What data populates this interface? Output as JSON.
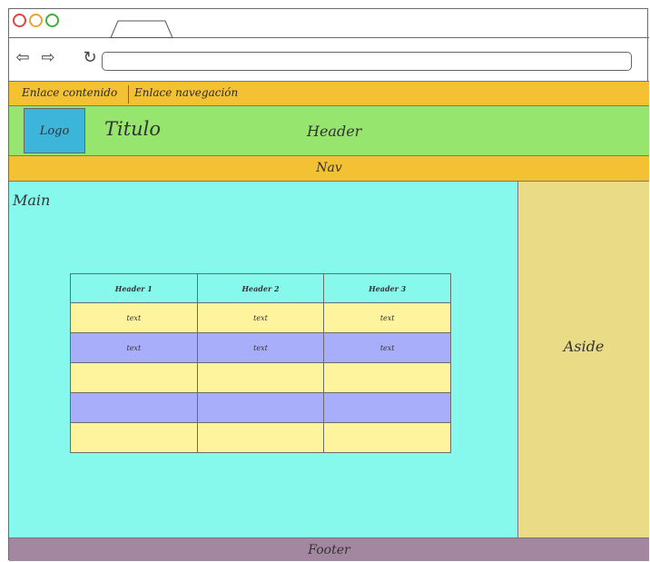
{
  "browser": {
    "back_icon": "⇦",
    "forward_icon": "⇨",
    "reload_icon": "↻"
  },
  "links_bar": {
    "link1": "Enlace contenido",
    "link2": "Enlace navegación"
  },
  "header": {
    "logo": "Logo",
    "title": "Titulo",
    "label": "Header"
  },
  "nav": {
    "label": "Nav"
  },
  "main": {
    "label": "Main",
    "table": {
      "headers": [
        "Header 1",
        "Header 2",
        "Header 3"
      ],
      "rows": [
        [
          "text",
          "text",
          "text"
        ],
        [
          "text",
          "text",
          "text"
        ],
        [
          "",
          "",
          ""
        ],
        [
          "",
          "",
          ""
        ],
        [
          "",
          "",
          ""
        ]
      ]
    }
  },
  "aside": {
    "label": "Aside"
  },
  "footer": {
    "label": "Footer"
  },
  "colors": {
    "links_bar": "#f4c134",
    "header": "#96e56f",
    "logo": "#3db4d9",
    "main": "#87f9ec",
    "aside": "#eadc87",
    "footer": "#a3869f",
    "row_yellow": "#fff49e",
    "row_blue": "#a9aefa"
  }
}
